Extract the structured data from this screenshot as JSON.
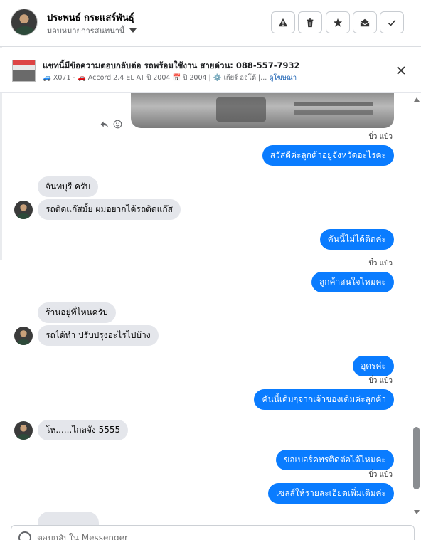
{
  "header": {
    "contact_name": "ประพนธ์ กระแสร์พันธุ์",
    "assign_label": "มอบหมายการสนทนานี้",
    "actions": [
      "warning-icon",
      "trash-icon",
      "star-icon",
      "mark-unread-icon",
      "check-icon"
    ]
  },
  "ad": {
    "title": "แชทนี้มีข้อความตอบกลับต่อ รถพร้อมใช้งาน สายด่วน: 088-557-7932",
    "meta": "🚙 X071 - 🚗 Accord 2.4 EL AT ปี 2004 📅 ปี 2004 | ⚙️ เกียร์ ออโต้ |...",
    "link": "ดูโฆษณา"
  },
  "messages": [
    {
      "side": "out",
      "text": "สวัสดีค่ะลูกค้าอยู่จังหวัดอะไรคะ",
      "seen": "บิ๋ว แป๋ว"
    },
    {
      "side": "in",
      "text": "จันทบุรี ครับ"
    },
    {
      "side": "in",
      "text": "รถติดแก๊สมั้ย ผมอยากได้รถติดแก๊ส"
    },
    {
      "side": "out",
      "text": "คันนี้ไม่ได้ติดค่ะ"
    },
    {
      "side": "out",
      "text": "ลูกค้าสนใจไหมคะ",
      "seen": "บิ๋ว แป๋ว"
    },
    {
      "side": "in",
      "text": "ร้านอยู่ที่ไหนครับ"
    },
    {
      "side": "in",
      "text": "รถได้ทำ ปรับปรุงอะไรไปบ้าง"
    },
    {
      "side": "out",
      "text": "อุดรค่ะ"
    },
    {
      "side": "out",
      "text": "คันนี้เดิมๆจากเจ้าของเดิมค่ะลูกค้า",
      "seen": "บิ๋ว แป๋ว"
    },
    {
      "side": "in",
      "text": "โห......ไกลจัง 5555"
    },
    {
      "side": "out",
      "text": "ขอเบอร์คทรติดต่อได้ไหมคะ"
    },
    {
      "side": "out",
      "text": "เซลส์ให้รายละเอียดเพิ่มเติมค่ะ",
      "seen": "บิ๋ว แป๋ว"
    }
  ],
  "composer": {
    "placeholder": "ตอบกลับใน Messenger"
  },
  "colors": {
    "outgoing_bubble": "#0a7cff",
    "incoming_bubble": "#e4e6eb"
  }
}
